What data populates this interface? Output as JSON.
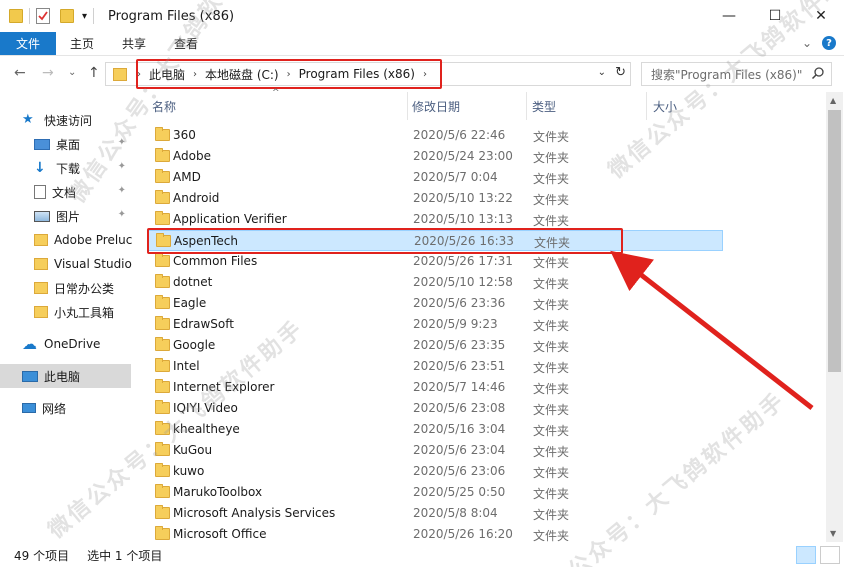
{
  "window": {
    "title": "Program Files (x86)",
    "minimize": "—",
    "maximize": "☐",
    "close": "✕"
  },
  "ribbon": {
    "tabs": [
      "文件",
      "主页",
      "共享",
      "查看"
    ],
    "expand": "⌄",
    "help": "?"
  },
  "nav": {
    "back": "←",
    "forward": "→",
    "recent": "⌄",
    "up": "↑"
  },
  "address": {
    "crumbs": [
      "此电脑",
      "本地磁盘 (C:)",
      "Program Files (x86)"
    ],
    "sep": "›",
    "dropdown": "⌄",
    "refresh": "↻"
  },
  "search": {
    "placeholder": "搜索\"Program Files (x86)\""
  },
  "sidebar": {
    "quick_access": "快速访问",
    "items": [
      {
        "label": "桌面",
        "icon": "desktop-icon",
        "pinned": true
      },
      {
        "label": "下载",
        "icon": "download-icon",
        "pinned": true
      },
      {
        "label": "文档",
        "icon": "document-icon",
        "pinned": true
      },
      {
        "label": "图片",
        "icon": "picture-icon",
        "pinned": true
      },
      {
        "label": "Adobe Preluc",
        "icon": "folder-icon",
        "pinned": false
      },
      {
        "label": "Visual Studio",
        "icon": "folder-icon",
        "pinned": false
      },
      {
        "label": "日常办公类",
        "icon": "folder-icon",
        "pinned": false
      },
      {
        "label": "小丸工具箱",
        "icon": "folder-icon",
        "pinned": false
      }
    ],
    "onedrive": "OneDrive",
    "this_pc": "此电脑",
    "network": "网络"
  },
  "columns": {
    "name": "名称",
    "date": "修改日期",
    "type": "类型",
    "size": "大小",
    "sort_indicator": "^"
  },
  "files": [
    {
      "name": "360",
      "date": "2020/5/6 22:46",
      "type": "文件夹"
    },
    {
      "name": "Adobe",
      "date": "2020/5/24 23:00",
      "type": "文件夹"
    },
    {
      "name": "AMD",
      "date": "2020/5/7 0:04",
      "type": "文件夹"
    },
    {
      "name": "Android",
      "date": "2020/5/10 13:22",
      "type": "文件夹"
    },
    {
      "name": "Application Verifier",
      "date": "2020/5/10 13:13",
      "type": "文件夹"
    },
    {
      "name": "AspenTech",
      "date": "2020/5/26 16:33",
      "type": "文件夹",
      "selected": true
    },
    {
      "name": "Common Files",
      "date": "2020/5/26 17:31",
      "type": "文件夹"
    },
    {
      "name": "dotnet",
      "date": "2020/5/10 12:58",
      "type": "文件夹"
    },
    {
      "name": "Eagle",
      "date": "2020/5/6 23:36",
      "type": "文件夹"
    },
    {
      "name": "EdrawSoft",
      "date": "2020/5/9 9:23",
      "type": "文件夹"
    },
    {
      "name": "Google",
      "date": "2020/5/6 23:35",
      "type": "文件夹"
    },
    {
      "name": "Intel",
      "date": "2020/5/6 23:51",
      "type": "文件夹"
    },
    {
      "name": "Internet Explorer",
      "date": "2020/5/7 14:46",
      "type": "文件夹"
    },
    {
      "name": "IQIYI Video",
      "date": "2020/5/6 23:08",
      "type": "文件夹"
    },
    {
      "name": "khealtheye",
      "date": "2020/5/16 3:04",
      "type": "文件夹"
    },
    {
      "name": "KuGou",
      "date": "2020/5/6 23:04",
      "type": "文件夹"
    },
    {
      "name": "kuwo",
      "date": "2020/5/6 23:06",
      "type": "文件夹"
    },
    {
      "name": "MarukoToolbox",
      "date": "2020/5/25 0:50",
      "type": "文件夹"
    },
    {
      "name": "Microsoft Analysis Services",
      "date": "2020/5/8 8:04",
      "type": "文件夹"
    },
    {
      "name": "Microsoft Office",
      "date": "2020/5/26 16:20",
      "type": "文件夹"
    }
  ],
  "status": {
    "count": "49 个项目",
    "selected": "选中 1 个项目"
  },
  "watermarks": [
    "微信公众号：大飞鸽软件助手",
    "微信公众号：大飞鸽软件助手",
    "公众号：大飞鸽软件助手",
    "微信公众号：大飞鸽软件助手"
  ],
  "colors": {
    "accent": "#1979ca",
    "selection": "#cce8ff",
    "highlight_box": "#e0221d"
  }
}
